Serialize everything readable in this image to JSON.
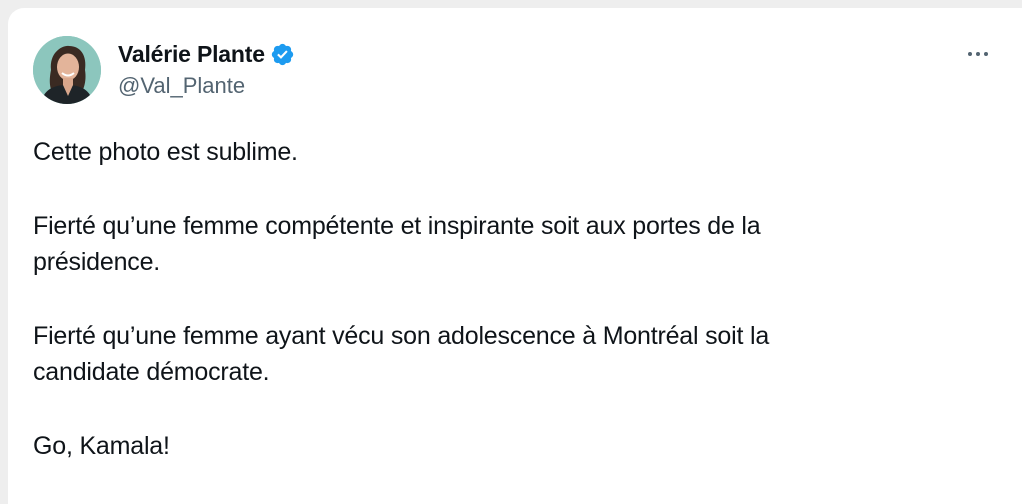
{
  "author": {
    "display_name": "Valérie Plante",
    "handle": "@Val_Plante",
    "verified": true,
    "verified_color": "#1d9bf0"
  },
  "more_icon": "more-horizontal-icon",
  "tweet": {
    "paragraphs": [
      {
        "lines": [
          "Cette photo est sublime."
        ]
      },
      {
        "lines": [
          "Fierté qu’une femme compétente et inspirante soit aux portes de la",
          "présidence."
        ]
      },
      {
        "lines": [
          "Fierté qu’une femme ayant vécu son adolescence à Montréal soit la",
          "candidate démocrate."
        ]
      },
      {
        "lines": [
          "Go, Kamala!"
        ]
      }
    ]
  }
}
